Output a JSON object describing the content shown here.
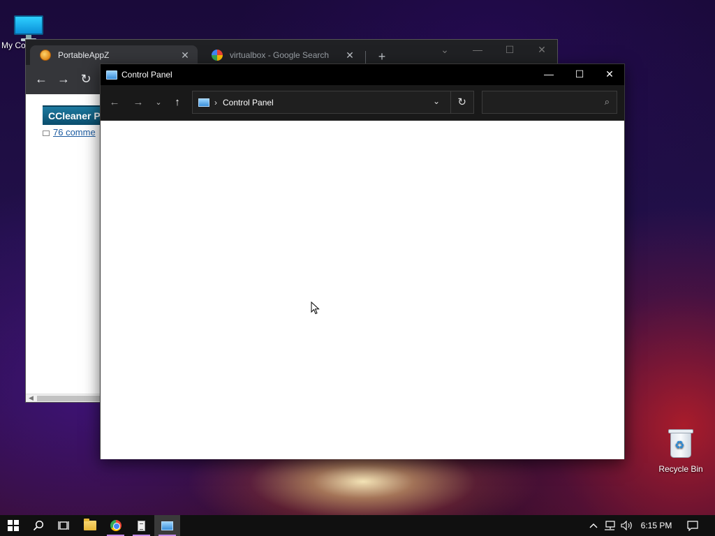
{
  "desktop": {
    "icons": [
      {
        "label": "My Co"
      },
      {
        "label": "Recycle Bin"
      }
    ]
  },
  "browser": {
    "tabs": [
      {
        "title": "PortableAppZ"
      },
      {
        "title": "virtualbox - Google Search"
      }
    ],
    "new_tab_label": "+",
    "content": {
      "heading": "CCleaner P",
      "comments_link": "76 comme"
    }
  },
  "explorer": {
    "title": "Control Panel",
    "address": {
      "crumbs": [
        "Control Panel"
      ]
    },
    "search": {
      "placeholder": "",
      "value": ""
    }
  },
  "taskbar": {
    "items": [
      "start",
      "search",
      "task-view",
      "file-explorer",
      "chrome",
      "document",
      "control-panel"
    ],
    "tray": {
      "time": "6:15 PM"
    }
  },
  "colors": {
    "taskbar_bg": "#101010",
    "explorer_titlebar": "#000000",
    "running_indicator": "#c48be8"
  }
}
